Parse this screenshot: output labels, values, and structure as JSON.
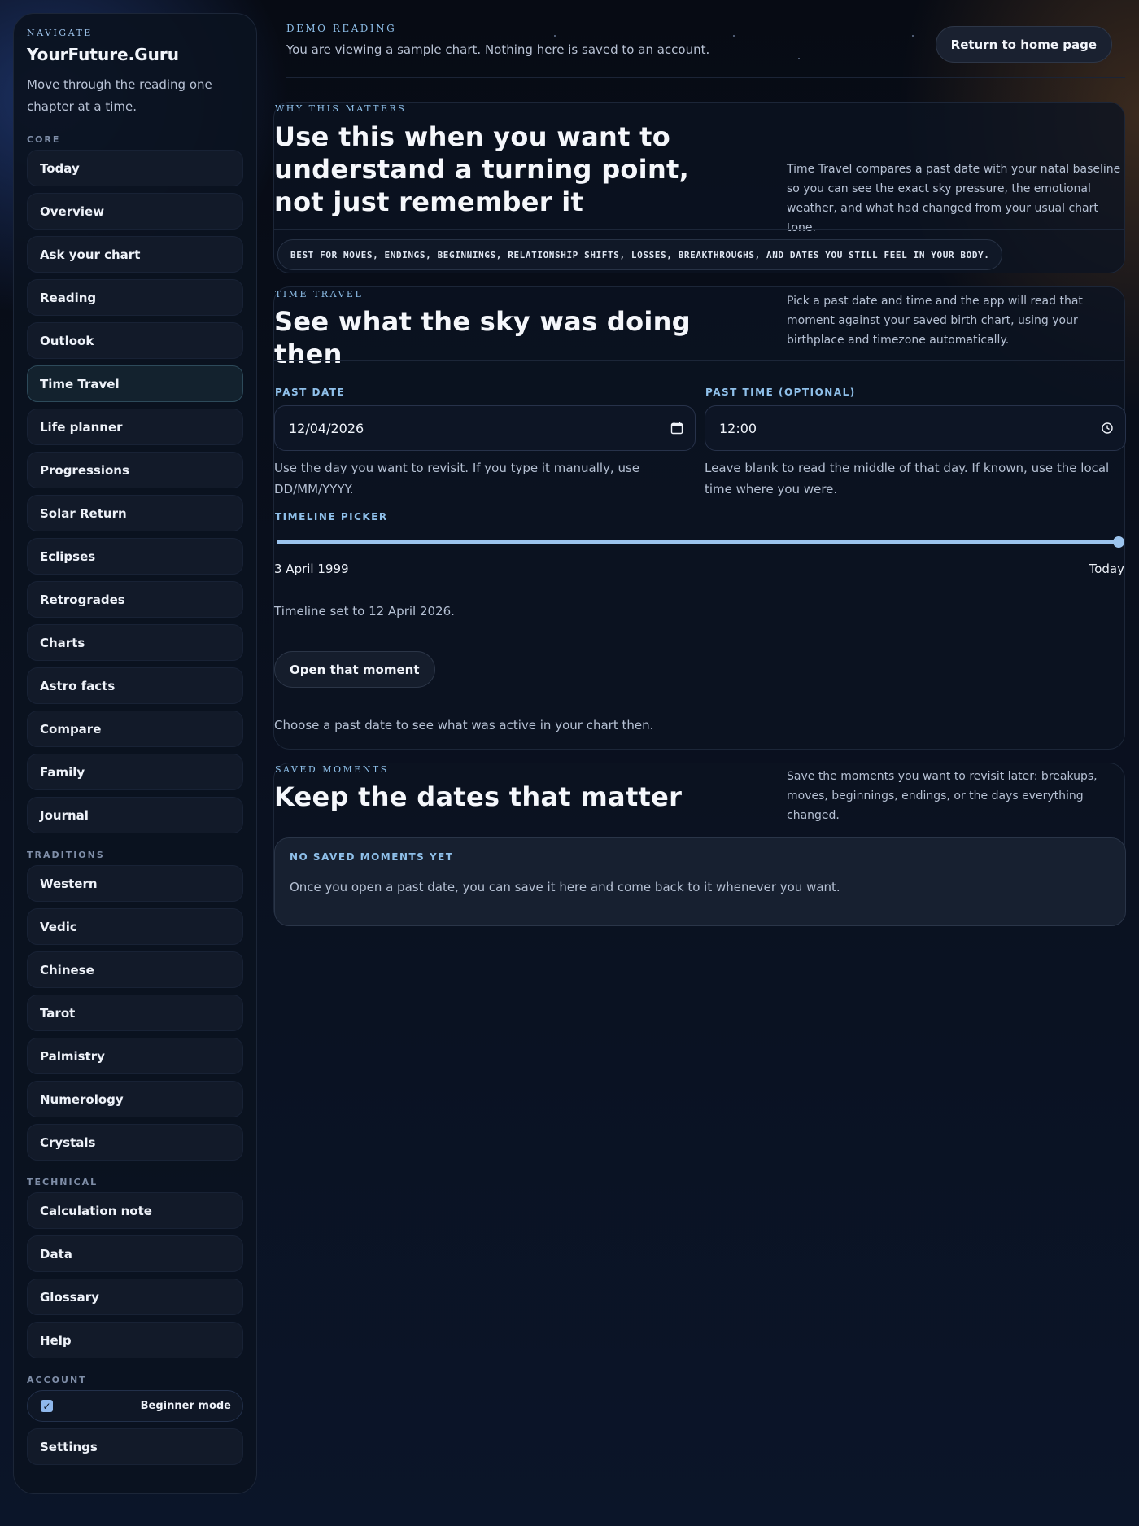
{
  "sidebar": {
    "eyebrow": "NAVIGATE",
    "brand": "YourFuture.Guru",
    "subtitle": "Move through the reading one chapter at a time.",
    "groups": {
      "core": {
        "label": "CORE",
        "items": [
          "Today",
          "Overview",
          "Ask your chart",
          "Reading",
          "Outlook",
          "Time Travel",
          "Life planner",
          "Progressions",
          "Solar Return",
          "Eclipses",
          "Retrogrades",
          "Charts",
          "Astro facts",
          "Compare",
          "Family",
          "Journal"
        ],
        "active": "Time Travel"
      },
      "traditions": {
        "label": "TRADITIONS",
        "items": [
          "Western",
          "Vedic",
          "Chinese",
          "Tarot",
          "Palmistry",
          "Numerology",
          "Crystals"
        ]
      },
      "technical": {
        "label": "TECHNICAL",
        "items": [
          "Calculation note",
          "Data",
          "Glossary",
          "Help"
        ]
      },
      "account": {
        "label": "ACCOUNT",
        "beginner_mode_label": "Beginner mode",
        "beginner_mode_checked": true,
        "settings": "Settings"
      }
    }
  },
  "topbar": {
    "eyebrow": "DEMO READING",
    "text": "You are viewing a sample chart. Nothing here is saved to an account.",
    "home_button": "Return to home page"
  },
  "why": {
    "eyebrow": "WHY THIS MATTERS",
    "title": "Use this when you want to understand a turning point, not just remember it",
    "note": "Time Travel compares a past date with your natal baseline so you can see the exact sky pressure, the emotional weather, and what had changed from your usual chart tone.",
    "pill": "BEST FOR MOVES, ENDINGS, BEGINNINGS, RELATIONSHIP SHIFTS, LOSSES, BREAKTHROUGHS, AND DATES YOU STILL FEEL IN YOUR BODY."
  },
  "time_travel": {
    "eyebrow": "TIME TRAVEL",
    "title": "See what the sky was doing then",
    "note": "Pick a past date and time and the app will read that moment against your saved birth chart, using your birthplace and timezone automatically.",
    "past_date": {
      "label": "PAST DATE",
      "value": "12/04/2026",
      "hint": "Use the day you want to revisit. If you type it manually, use DD/MM/YYYY."
    },
    "past_time": {
      "label": "PAST TIME (OPTIONAL)",
      "value": "12:00",
      "hint": "Leave blank to read the middle of that day. If known, use the local time where you were."
    },
    "timeline": {
      "label": "TIMELINE PICKER",
      "start_label": "3 April 1999",
      "end_label": "Today",
      "position_fraction": 1.0,
      "status": "Timeline set to 12 April 2026."
    },
    "open_button": "Open that moment",
    "footer": "Choose a past date to see what was active in your chart then."
  },
  "saved": {
    "eyebrow": "SAVED MOMENTS",
    "title": "Keep the dates that matter",
    "note": "Save the moments you want to revisit later: breakups, moves, beginnings, endings, or the days everything changed.",
    "empty_title": "NO SAVED MOMENTS YET",
    "empty_text": "Once you open a past date, you can save it here and come back to it whenever you want."
  },
  "colors": {
    "accent": "#8fc0ea",
    "slider": "#9cc4ee",
    "background": "#0a1120"
  },
  "icons": {
    "date_field": "calendar-icon",
    "time_field": "clock-icon",
    "beginner_mode": "checkbox-checked-icon"
  }
}
